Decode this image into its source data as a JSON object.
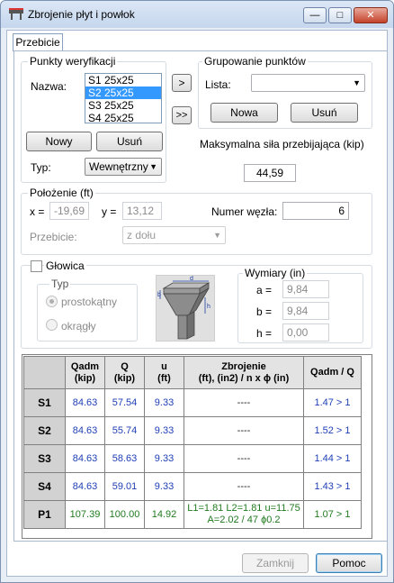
{
  "window": {
    "title": "Zbrojenie płyt i powłok",
    "minimize_glyph": "—",
    "restore_glyph": "□",
    "close_glyph": "✕"
  },
  "tab": {
    "label": "Przebicie"
  },
  "verification_points": {
    "legend": "Punkty weryfikacji",
    "name_label": "Nazwa:",
    "items": [
      "S1 25x25",
      "S2 25x25",
      "S3 25x25",
      "S4 25x25"
    ],
    "selected_index": 1,
    "new_button": "Nowy",
    "delete_button": "Usuń",
    "type_label": "Typ:",
    "type_value": "Wewnętrzny"
  },
  "transfer_buttons": {
    "add": ">",
    "add_all": ">>"
  },
  "point_grouping": {
    "legend": "Grupowanie punktów",
    "list_label": "Lista:",
    "list_value": "",
    "new_button": "Nowa",
    "delete_button": "Usuń"
  },
  "max_force": {
    "label": "Maksymalna siła przebijająca (kip)",
    "value": "44,59"
  },
  "position": {
    "legend": "Położenie (ft)",
    "x_label": "x =",
    "x_value": "-19,69",
    "y_label": "y =",
    "y_value": "13,12",
    "node_label": "Numer węzła:",
    "node_value": "6",
    "punching_label": "Przebicie:",
    "punching_value": "z dołu"
  },
  "head": {
    "checkbox_label": "Głowica",
    "type_legend": "Typ",
    "rect_label": "prostokątny",
    "round_label": "okrągły",
    "dims_legend": "Wymiary (in)",
    "a_label": "a =",
    "a_value": "9,84",
    "b_label": "b =",
    "b_value": "9,84",
    "h_label": "h =",
    "h_value": "0,00",
    "diagram_letters": {
      "b": "b",
      "d": "d",
      "h": "h"
    }
  },
  "results_table": {
    "headers": {
      "qadm": [
        "Qadm",
        "(kip)"
      ],
      "q": [
        "Q",
        "(kip)"
      ],
      "u": [
        "u",
        "(ft)"
      ],
      "reinf": [
        "Zbrojenie",
        "(ft), (in2) / n x ϕ (in)"
      ],
      "ratio": "Qadm / Q"
    },
    "rows": [
      {
        "name": "S1",
        "qadm": "84.63",
        "q": "57.54",
        "u": "9.33",
        "reinf": "----",
        "ratio": "1.47 > 1"
      },
      {
        "name": "S2",
        "qadm": "84.63",
        "q": "55.74",
        "u": "9.33",
        "reinf": "----",
        "ratio": "1.52 > 1"
      },
      {
        "name": "S3",
        "qadm": "84.63",
        "q": "58.63",
        "u": "9.33",
        "reinf": "----",
        "ratio": "1.44 > 1"
      },
      {
        "name": "S4",
        "qadm": "84.63",
        "q": "59.01",
        "u": "9.33",
        "reinf": "----",
        "ratio": "1.43 > 1"
      },
      {
        "name": "P1",
        "qadm": "107.39",
        "q": "100.00",
        "u": "14.92",
        "reinf_line1": "L1=1.81 L2=1.81 u=11.75",
        "reinf_line2": "A=2.02 / 47 ϕ0.2",
        "ratio": "1.07 > 1"
      }
    ]
  },
  "footer": {
    "close_button": "Zamknij",
    "help_button": "Pomoc"
  },
  "colors": {
    "blue_values": "#1f3fb5",
    "green_values": "#1f7a1f",
    "selection": "#3399ff"
  }
}
